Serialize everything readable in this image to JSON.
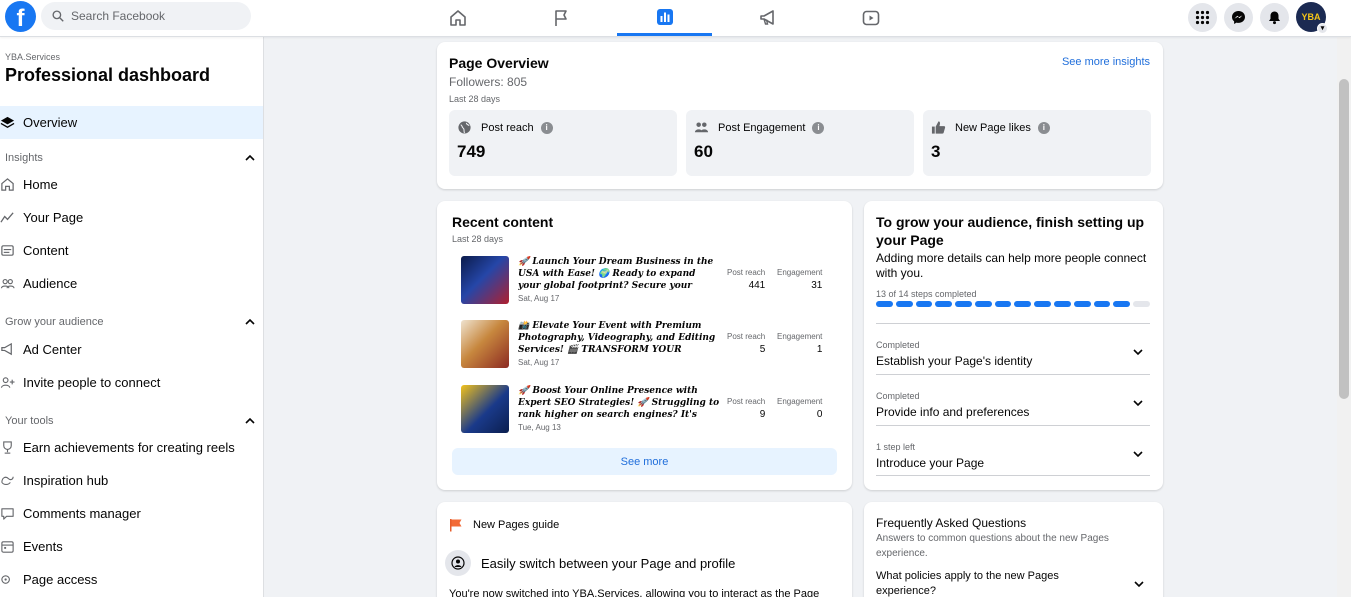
{
  "topbar": {
    "logo": "f",
    "search_placeholder": "Search Facebook",
    "nav": [
      "home-icon",
      "flag-icon",
      "chart-icon",
      "megaphone-icon",
      "video-icon"
    ],
    "active_nav": "chart-icon",
    "avatar_text": "YBA"
  },
  "sidebar": {
    "page_name": "YBA.Services",
    "title": "Professional dashboard",
    "overview": "Overview",
    "sections": [
      {
        "label": "Insights",
        "items": [
          "Home",
          "Your Page",
          "Content",
          "Audience"
        ]
      },
      {
        "label": "Grow your audience",
        "items": [
          "Ad Center",
          "Invite people to connect"
        ]
      },
      {
        "label": "Your tools",
        "items": [
          "Earn achievements for creating reels",
          "Inspiration hub",
          "Comments manager",
          "Events",
          "Page access"
        ]
      }
    ]
  },
  "overview": {
    "title": "Page Overview",
    "followers": "Followers: 805",
    "period": "Last 28 days",
    "insights_link": "See more insights",
    "metrics": [
      {
        "label": "Post reach",
        "value": "749",
        "icon": "globe-icon"
      },
      {
        "label": "Post Engagement",
        "value": "60",
        "icon": "people-icon"
      },
      {
        "label": "New Page likes",
        "value": "3",
        "icon": "thumbs-up-icon"
      }
    ]
  },
  "recent": {
    "title": "Recent content",
    "period": "Last 28 days",
    "reach_label": "Post reach",
    "engagement_label": "Engagement",
    "posts": [
      {
        "text": "🚀 Launch Your Dream Business in the USA with Ease! 🌍 Ready to expand your global footprint? Secure your company…",
        "date": "Sat, Aug 17",
        "reach": "441",
        "engagement": "31"
      },
      {
        "text": "📸 Elevate Your Event with Premium Photography, Videography, and Editing Services! 🎬 TRANSFORM YOUR SPECIAL…",
        "date": "Sat, Aug 17",
        "reach": "5",
        "engagement": "1"
      },
      {
        "text": "🚀 Boost Your Online Presence with Expert SEO Strategies! 🚀 Struggling to rank higher on search engines? It's time to elevate your…",
        "date": "Tue, Aug 13",
        "reach": "9",
        "engagement": "0"
      }
    ],
    "see_more": "See more"
  },
  "grow": {
    "title": "To grow your audience, finish setting up your Page",
    "subtitle": "Adding more details can help more people connect with you.",
    "steps_text": "13 of 14 steps completed",
    "steps_completed": 13,
    "steps_total": 14,
    "rows": [
      {
        "status": "Completed",
        "label": "Establish your Page's identity"
      },
      {
        "status": "Completed",
        "label": "Provide info and preferences"
      },
      {
        "status": "1 step left",
        "label": "Introduce your Page"
      }
    ]
  },
  "guide": {
    "title": "New Pages guide",
    "row_label": "Easily switch between your Page and profile",
    "text": "You're now switched into YBA.Services, allowing you to interact as the Page"
  },
  "faq": {
    "title": "Frequently Asked Questions",
    "subtitle": "Answers to common questions about the new Pages experience.",
    "question": "What policies apply to the new Pages experience?"
  },
  "colors": {
    "brand": "#1877f2",
    "link": "#216fdb",
    "active_bg": "#e7f3ff"
  }
}
